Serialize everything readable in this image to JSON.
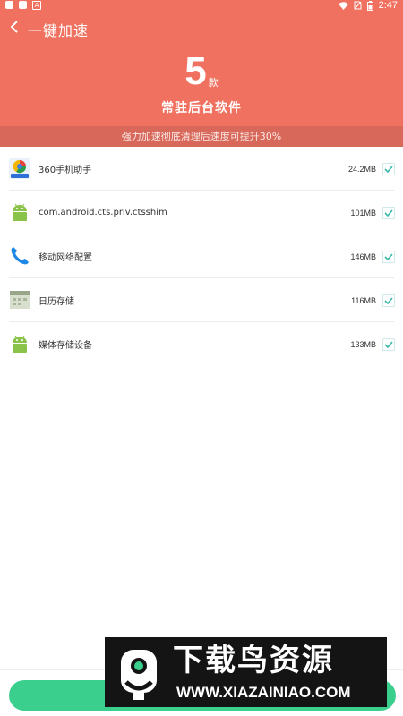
{
  "status_bar": {
    "time": "2:47",
    "notification_letter": "A"
  },
  "header": {
    "title": "一键加速",
    "count": "5",
    "count_unit": "款",
    "subtitle": "常驻后台软件"
  },
  "tip": "强力加速彻底清理后速度可提升30%",
  "apps": [
    {
      "name": "360手机助手",
      "size": "24.2MB",
      "icon": "360-assistant-icon",
      "checked": true
    },
    {
      "name": "com.android.cts.priv.ctsshim",
      "size": "101MB",
      "icon": "android-icon",
      "checked": true
    },
    {
      "name": "移动网络配置",
      "size": "146MB",
      "icon": "phone-icon",
      "checked": true
    },
    {
      "name": "日历存储",
      "size": "116MB",
      "icon": "calendar-storage-icon",
      "checked": true
    },
    {
      "name": "媒体存储设备",
      "size": "133MB",
      "icon": "android-icon",
      "checked": true
    }
  ],
  "watermark": {
    "title": "下载鸟资源",
    "url": "WWW.XIAZAINIAO.COM"
  },
  "colors": {
    "header": "#f0715f",
    "banner": "#d7685a",
    "check": "#3bb8a8",
    "button": "#3bcf8d"
  }
}
